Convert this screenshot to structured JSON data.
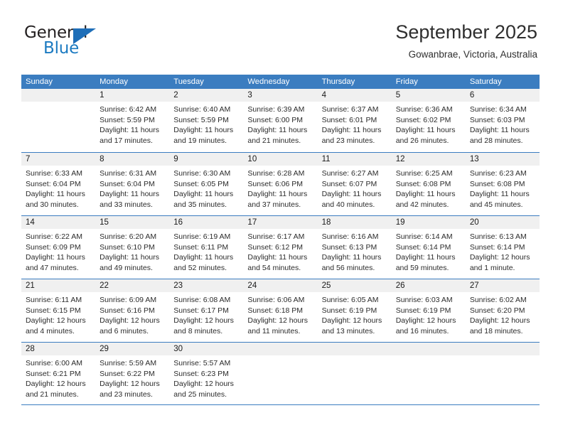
{
  "brand": {
    "name_top": "General",
    "name_bottom": "Blue",
    "color_dark": "#231f20",
    "color_blue": "#1b7ac1"
  },
  "header": {
    "title": "September 2025",
    "location": "Gowanbrae, Victoria, Australia"
  },
  "theme": {
    "header_blue": "#3b7dc0",
    "date_band_gray": "#f0f0f0",
    "text": "#2b2b2b"
  },
  "weekdays": [
    "Sunday",
    "Monday",
    "Tuesday",
    "Wednesday",
    "Thursday",
    "Friday",
    "Saturday"
  ],
  "weeks": [
    [
      {
        "empty": true
      },
      {
        "date": "1",
        "sunrise": "Sunrise: 6:42 AM",
        "sunset": "Sunset: 5:59 PM",
        "daylight1": "Daylight: 11 hours",
        "daylight2": "and 17 minutes."
      },
      {
        "date": "2",
        "sunrise": "Sunrise: 6:40 AM",
        "sunset": "Sunset: 5:59 PM",
        "daylight1": "Daylight: 11 hours",
        "daylight2": "and 19 minutes."
      },
      {
        "date": "3",
        "sunrise": "Sunrise: 6:39 AM",
        "sunset": "Sunset: 6:00 PM",
        "daylight1": "Daylight: 11 hours",
        "daylight2": "and 21 minutes."
      },
      {
        "date": "4",
        "sunrise": "Sunrise: 6:37 AM",
        "sunset": "Sunset: 6:01 PM",
        "daylight1": "Daylight: 11 hours",
        "daylight2": "and 23 minutes."
      },
      {
        "date": "5",
        "sunrise": "Sunrise: 6:36 AM",
        "sunset": "Sunset: 6:02 PM",
        "daylight1": "Daylight: 11 hours",
        "daylight2": "and 26 minutes."
      },
      {
        "date": "6",
        "sunrise": "Sunrise: 6:34 AM",
        "sunset": "Sunset: 6:03 PM",
        "daylight1": "Daylight: 11 hours",
        "daylight2": "and 28 minutes."
      }
    ],
    [
      {
        "date": "7",
        "sunrise": "Sunrise: 6:33 AM",
        "sunset": "Sunset: 6:04 PM",
        "daylight1": "Daylight: 11 hours",
        "daylight2": "and 30 minutes."
      },
      {
        "date": "8",
        "sunrise": "Sunrise: 6:31 AM",
        "sunset": "Sunset: 6:04 PM",
        "daylight1": "Daylight: 11 hours",
        "daylight2": "and 33 minutes."
      },
      {
        "date": "9",
        "sunrise": "Sunrise: 6:30 AM",
        "sunset": "Sunset: 6:05 PM",
        "daylight1": "Daylight: 11 hours",
        "daylight2": "and 35 minutes."
      },
      {
        "date": "10",
        "sunrise": "Sunrise: 6:28 AM",
        "sunset": "Sunset: 6:06 PM",
        "daylight1": "Daylight: 11 hours",
        "daylight2": "and 37 minutes."
      },
      {
        "date": "11",
        "sunrise": "Sunrise: 6:27 AM",
        "sunset": "Sunset: 6:07 PM",
        "daylight1": "Daylight: 11 hours",
        "daylight2": "and 40 minutes."
      },
      {
        "date": "12",
        "sunrise": "Sunrise: 6:25 AM",
        "sunset": "Sunset: 6:08 PM",
        "daylight1": "Daylight: 11 hours",
        "daylight2": "and 42 minutes."
      },
      {
        "date": "13",
        "sunrise": "Sunrise: 6:23 AM",
        "sunset": "Sunset: 6:08 PM",
        "daylight1": "Daylight: 11 hours",
        "daylight2": "and 45 minutes."
      }
    ],
    [
      {
        "date": "14",
        "sunrise": "Sunrise: 6:22 AM",
        "sunset": "Sunset: 6:09 PM",
        "daylight1": "Daylight: 11 hours",
        "daylight2": "and 47 minutes."
      },
      {
        "date": "15",
        "sunrise": "Sunrise: 6:20 AM",
        "sunset": "Sunset: 6:10 PM",
        "daylight1": "Daylight: 11 hours",
        "daylight2": "and 49 minutes."
      },
      {
        "date": "16",
        "sunrise": "Sunrise: 6:19 AM",
        "sunset": "Sunset: 6:11 PM",
        "daylight1": "Daylight: 11 hours",
        "daylight2": "and 52 minutes."
      },
      {
        "date": "17",
        "sunrise": "Sunrise: 6:17 AM",
        "sunset": "Sunset: 6:12 PM",
        "daylight1": "Daylight: 11 hours",
        "daylight2": "and 54 minutes."
      },
      {
        "date": "18",
        "sunrise": "Sunrise: 6:16 AM",
        "sunset": "Sunset: 6:13 PM",
        "daylight1": "Daylight: 11 hours",
        "daylight2": "and 56 minutes."
      },
      {
        "date": "19",
        "sunrise": "Sunrise: 6:14 AM",
        "sunset": "Sunset: 6:14 PM",
        "daylight1": "Daylight: 11 hours",
        "daylight2": "and 59 minutes."
      },
      {
        "date": "20",
        "sunrise": "Sunrise: 6:13 AM",
        "sunset": "Sunset: 6:14 PM",
        "daylight1": "Daylight: 12 hours",
        "daylight2": "and 1 minute."
      }
    ],
    [
      {
        "date": "21",
        "sunrise": "Sunrise: 6:11 AM",
        "sunset": "Sunset: 6:15 PM",
        "daylight1": "Daylight: 12 hours",
        "daylight2": "and 4 minutes."
      },
      {
        "date": "22",
        "sunrise": "Sunrise: 6:09 AM",
        "sunset": "Sunset: 6:16 PM",
        "daylight1": "Daylight: 12 hours",
        "daylight2": "and 6 minutes."
      },
      {
        "date": "23",
        "sunrise": "Sunrise: 6:08 AM",
        "sunset": "Sunset: 6:17 PM",
        "daylight1": "Daylight: 12 hours",
        "daylight2": "and 8 minutes."
      },
      {
        "date": "24",
        "sunrise": "Sunrise: 6:06 AM",
        "sunset": "Sunset: 6:18 PM",
        "daylight1": "Daylight: 12 hours",
        "daylight2": "and 11 minutes."
      },
      {
        "date": "25",
        "sunrise": "Sunrise: 6:05 AM",
        "sunset": "Sunset: 6:19 PM",
        "daylight1": "Daylight: 12 hours",
        "daylight2": "and 13 minutes."
      },
      {
        "date": "26",
        "sunrise": "Sunrise: 6:03 AM",
        "sunset": "Sunset: 6:19 PM",
        "daylight1": "Daylight: 12 hours",
        "daylight2": "and 16 minutes."
      },
      {
        "date": "27",
        "sunrise": "Sunrise: 6:02 AM",
        "sunset": "Sunset: 6:20 PM",
        "daylight1": "Daylight: 12 hours",
        "daylight2": "and 18 minutes."
      }
    ],
    [
      {
        "date": "28",
        "sunrise": "Sunrise: 6:00 AM",
        "sunset": "Sunset: 6:21 PM",
        "daylight1": "Daylight: 12 hours",
        "daylight2": "and 21 minutes."
      },
      {
        "date": "29",
        "sunrise": "Sunrise: 5:59 AM",
        "sunset": "Sunset: 6:22 PM",
        "daylight1": "Daylight: 12 hours",
        "daylight2": "and 23 minutes."
      },
      {
        "date": "30",
        "sunrise": "Sunrise: 5:57 AM",
        "sunset": "Sunset: 6:23 PM",
        "daylight1": "Daylight: 12 hours",
        "daylight2": "and 25 minutes."
      },
      {
        "empty": true
      },
      {
        "empty": true
      },
      {
        "empty": true
      },
      {
        "empty": true
      }
    ]
  ]
}
